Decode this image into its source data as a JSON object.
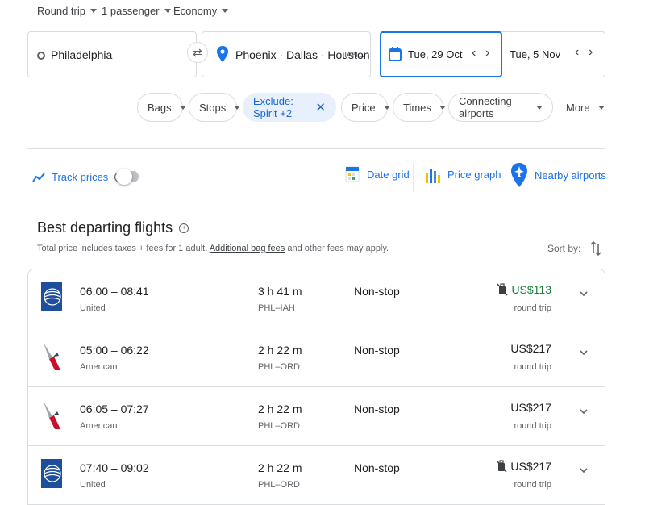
{
  "trip_options": {
    "trip_type": "Round trip",
    "passengers": "1 passenger",
    "cabin": "Economy"
  },
  "search": {
    "origin": "Philadelphia",
    "destinations": "Phoenix · Dallas · Houston",
    "destinations_more": "IAH...",
    "depart_date": "Tue, 29 Oct",
    "return_date": "Tue, 5 Nov"
  },
  "filters": [
    {
      "label": "Bags"
    },
    {
      "label": "Stops"
    },
    {
      "label": "Exclude: Spirit +2",
      "active": true
    },
    {
      "label": "Price"
    },
    {
      "label": "Times"
    },
    {
      "label": "Connecting airports"
    },
    {
      "label": "More"
    }
  ],
  "tools": {
    "track_prices": "Track prices",
    "date_grid": "Date grid",
    "price_graph": "Price graph",
    "nearby_airports": "Nearby airports"
  },
  "results": {
    "title": "Best departing flights",
    "subtitle_before": "Total price includes taxes + fees for 1 adult.",
    "subtitle_link": "Additional bag fees",
    "subtitle_after": "and other fees may apply.",
    "sort_label": "Sort by:"
  },
  "flights": [
    {
      "times": "06:00 – 08:41",
      "airline": "United",
      "duration": "3 h 41 m",
      "route": "PHL–IAH",
      "stops": "Non-stop",
      "price": "US$113",
      "price_note": "round trip",
      "logo": "united-logo",
      "no_carry_on": true,
      "cheap": true
    },
    {
      "times": "05:00 – 06:22",
      "airline": "American",
      "duration": "2 h 22 m",
      "route": "PHL–ORD",
      "stops": "Non-stop",
      "price": "US$217",
      "price_note": "round trip",
      "logo": "american-logo",
      "no_carry_on": false,
      "cheap": false
    },
    {
      "times": "06:05 – 07:27",
      "airline": "American",
      "duration": "2 h 22 m",
      "route": "PHL–ORD",
      "stops": "Non-stop",
      "price": "US$217",
      "price_note": "round trip",
      "logo": "american-logo",
      "no_carry_on": false,
      "cheap": false
    },
    {
      "times": "07:40 – 09:02",
      "airline": "United",
      "duration": "2 h 22 m",
      "route": "PHL–ORD",
      "stops": "Non-stop",
      "price": "US$217",
      "price_note": "round trip",
      "logo": "united-logo",
      "no_carry_on": true,
      "cheap": false
    }
  ],
  "colors": {
    "accent": "#1a73e8",
    "cheap_price": "#188038",
    "chip_active_bg": "#e8f0fe",
    "united_blue": "#1f4e9c",
    "american_red": "#c8102e"
  }
}
